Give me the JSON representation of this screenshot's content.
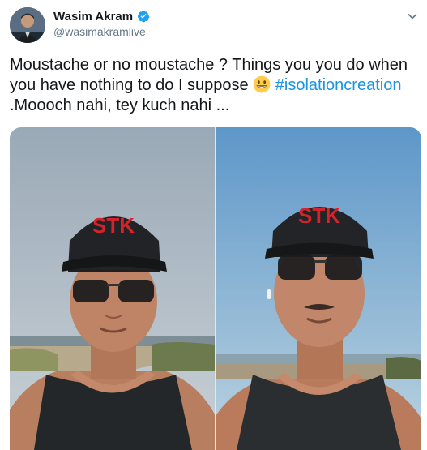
{
  "author": {
    "display_name": "Wasim Akram",
    "handle": "@wasimakramlive",
    "avatar_icon": "profile-avatar",
    "verified_icon": "verified-badge-icon",
    "verified_color": "#1da1f2"
  },
  "tweet": {
    "text_part1": "Moustache or no moustache ? Things you you do when you have nothing to do I suppose ",
    "emoji": "grinning-face-emoji",
    "hashtag": "#isolationcreation",
    "text_part2": ".Moooch nahi, tey kuch nahi ...",
    "hashtag_color": "#1b95e0"
  },
  "media": {
    "photo_left": {
      "cap_text": "STK",
      "description": "photo-left"
    },
    "photo_right": {
      "cap_text": "STK",
      "description": "photo-right"
    }
  },
  "menu": {
    "icon": "chevron-down-icon"
  }
}
